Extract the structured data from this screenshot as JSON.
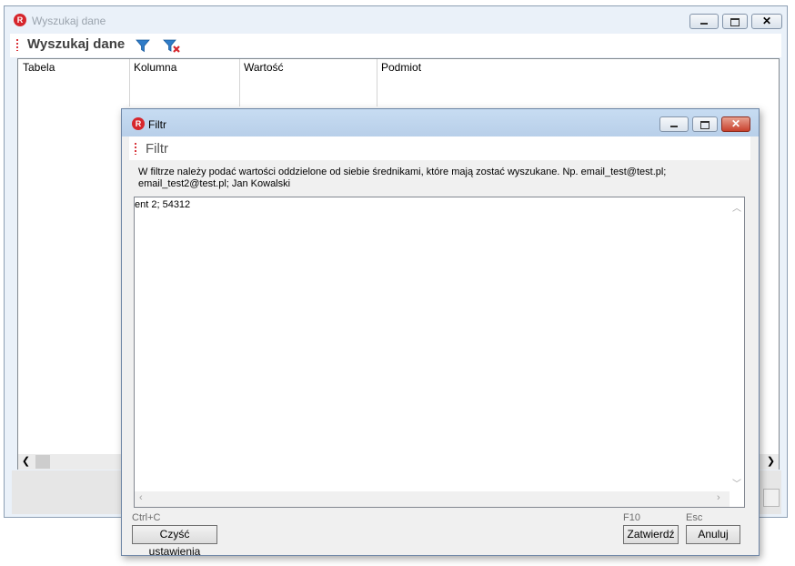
{
  "main_window": {
    "title": "Wyszukaj dane",
    "toolbar_title": "Wyszukaj dane",
    "icons": {
      "app": "app-logo-icon",
      "filter": "filter-icon",
      "clear_filter": "clear-filter-icon"
    },
    "app_icon_letter": "R",
    "grid": {
      "columns": [
        "Tabela",
        "Kolumna",
        "Wartość",
        "Podmiot"
      ]
    }
  },
  "dialog": {
    "title": "Filtr",
    "header": "Filtr",
    "app_icon_letter": "R",
    "instruction_line1": "W filtrze należy podać wartości oddzielone od siebie średnikami, które mają zostać wyszukane. Np. email_test@test.pl;",
    "instruction_line2": "email_test2@test.pl; Jan Kowalski",
    "input_value": "ent 2; 54312",
    "buttons": {
      "clear": {
        "label": "Czyść ustawienia",
        "shortcut": "Ctrl+C"
      },
      "confirm": {
        "label": "Zatwierdź",
        "shortcut": "F10"
      },
      "cancel": {
        "label": "Anuluj",
        "shortcut": "Esc"
      }
    }
  },
  "colors": {
    "accent_red": "#d6262c",
    "filter_blue": "#2f7cc8",
    "window_frame": "#eaf1f9",
    "dialog_title": "#c7dcf2"
  }
}
